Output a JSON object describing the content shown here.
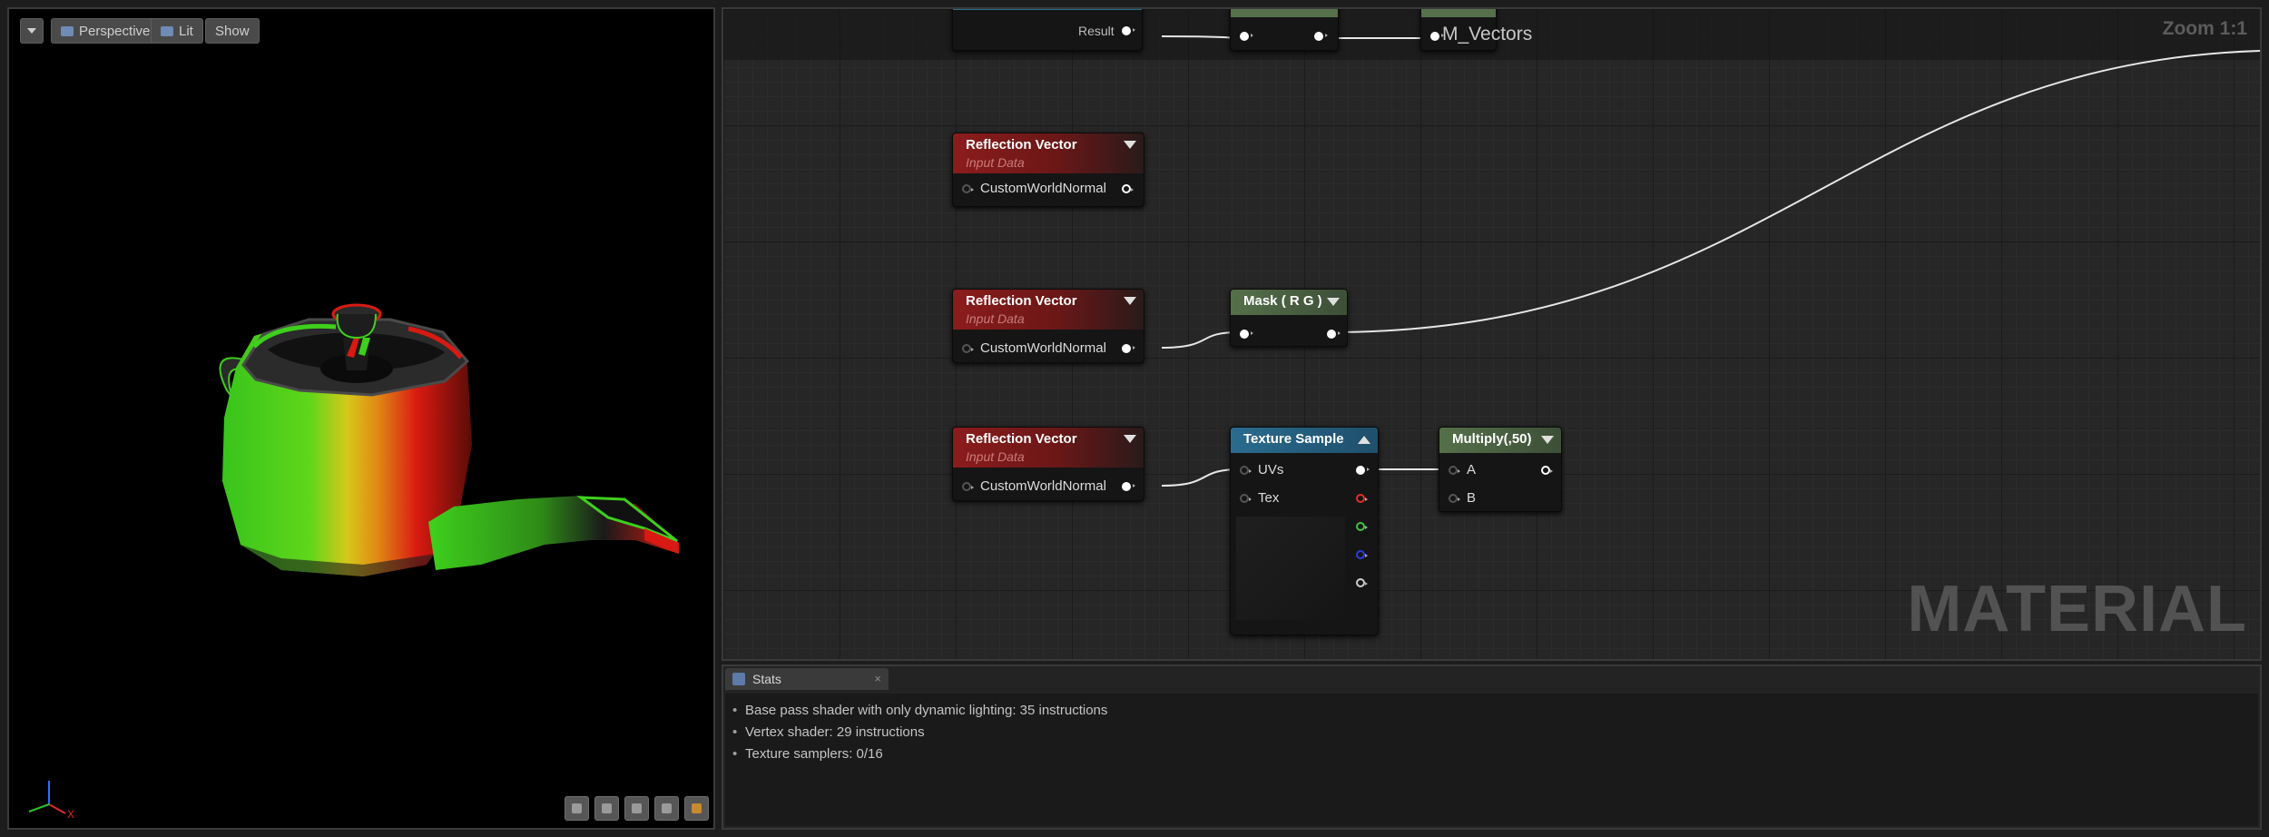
{
  "viewport": {
    "dropdown_icon": "chevron-down-icon",
    "perspective_label": "Perspective",
    "lit_label": "Lit",
    "show_label": "Show",
    "axis_x_label": "X"
  },
  "graph": {
    "title": "M_Vectors",
    "zoom_label": "Zoom 1:1",
    "watermark": "MATERIAL",
    "top_partial": {
      "result_label": "Result"
    },
    "nodes": [
      {
        "title": "Reflection Vector",
        "subtitle": "Input Data",
        "pin": "CustomWorldNormal"
      },
      {
        "title": "Reflection Vector",
        "subtitle": "Input Data",
        "pin": "CustomWorldNormal"
      },
      {
        "title": "Reflection Vector",
        "subtitle": "Input Data",
        "pin": "CustomWorldNormal"
      }
    ],
    "mask_node": {
      "title": "Mask ( R G )"
    },
    "texture_node": {
      "title": "Texture Sample",
      "pin_uvs": "UVs",
      "pin_tex": "Tex"
    },
    "multiply_node": {
      "title": "Multiply(,50)",
      "pin_a": "A",
      "pin_b": "B"
    }
  },
  "stats": {
    "tab_label": "Stats",
    "close_label": "×",
    "lines": [
      "Base pass shader with only dynamic lighting: 35 instructions",
      "Vertex shader: 29 instructions",
      "Texture samplers: 0/16"
    ]
  },
  "colors": {
    "node_red": "#8c1c1c",
    "node_green": "#55704a",
    "node_blue": "#2a6b8e",
    "wire": "#e6e6e6"
  }
}
